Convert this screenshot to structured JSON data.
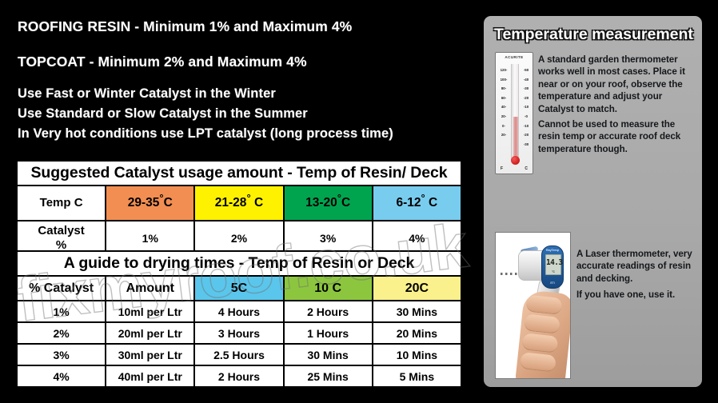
{
  "intro": {
    "resin_line": "ROOFING RESIN - Minimum 1%  and Maximum  4%",
    "topcoat_line": "TOPCOAT - Minimum 2%  and Maximum  4%",
    "catalyst_line_1": "Use Fast or Winter Catalyst in the  Winter",
    "catalyst_line_2": "Use Standard or Slow Catalyst in the Summer",
    "catalyst_line_3": "In Very hot conditions use LPT catalyst (long process time)"
  },
  "watermark": {
    "text": "fixmyroof.co.uk"
  },
  "table_usage": {
    "title": "Suggested Catalyst usage amount - Temp of Resin/ Deck",
    "row_label_temp": "Temp C",
    "row_label_catalyst_line1": "Catalyst",
    "row_label_catalyst_line2": "%",
    "temp_ranges": [
      {
        "range": "29-35",
        "deg": "°",
        "unit": "C",
        "color": "#F28E52"
      },
      {
        "range": "21-28",
        "deg": "°",
        "unit": " C",
        "color": "#FFF200"
      },
      {
        "range": "13-20",
        "deg": "°",
        "unit": "C",
        "color": "#00A44F"
      },
      {
        "range": "6-12",
        "deg": "°",
        "unit": " C",
        "color": "#78CCEE"
      }
    ],
    "catalyst_percents": [
      "1%",
      "2%",
      "3%",
      "4%"
    ]
  },
  "table_drying": {
    "title": "A guide to drying times  - Temp of Resin or Deck",
    "headers": [
      "% Catalyst",
      "Amount",
      "5C",
      "10 C",
      "20C"
    ],
    "header_colors": [
      "#FFFFFF",
      "#FFFFFF",
      "#5BC6EC",
      "#8CC63F",
      "#FAF08C"
    ],
    "rows": [
      [
        "1%",
        "10ml per Ltr",
        "4 Hours",
        "2 Hours",
        "30 Mins"
      ],
      [
        "2%",
        "20ml per Ltr",
        "3 Hours",
        "1 Hours",
        "20 Mins"
      ],
      [
        "3%",
        "30ml per Ltr",
        "2.5 Hours",
        "30 Mins",
        "10 Mins"
      ],
      [
        "4%",
        "40ml per Ltr",
        "2 Hours",
        "25 Mins",
        "5 Mins"
      ]
    ]
  },
  "panel": {
    "title": "Temperature  measurement",
    "thermometer": {
      "brand": "ACURITE",
      "scale_f": "120-\n100-\n80-\n60-\n40-\n20-\n0-\n20-",
      "scale_c": "-50\n-40\n-30\n-20\n-10\n-0\n-10\n-20\n-30",
      "unit_f": "F",
      "unit_c": "C",
      "text_block_1": "A standard garden thermometer works well in most cases. Place it near or on your roof, observe the temperature and adjust your Catalyst to match.",
      "text_block_2": "Cannot be used to measure the resin temp or accurate roof deck temperature though."
    },
    "laser": {
      "brand": "RayTemp",
      "reading": "14.3",
      "reading_unit": "°C",
      "logo": "ETI",
      "text_block_1": "A Laser thermometer, very accurate readings of resin and decking.",
      "text_block_2": "If you have one, use it."
    }
  }
}
